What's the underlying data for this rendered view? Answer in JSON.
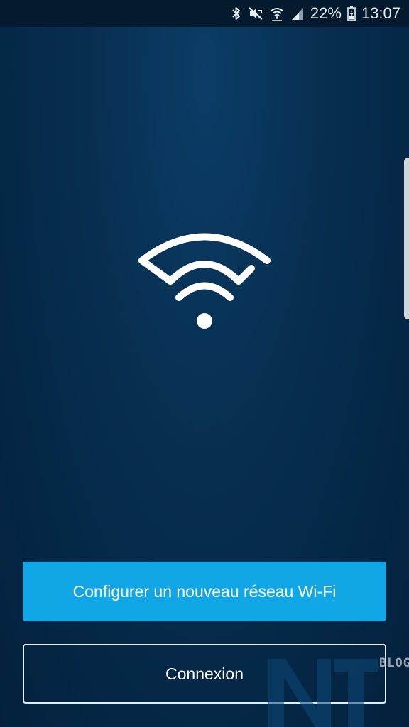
{
  "status_bar": {
    "battery_percent": "22%",
    "time": "13:07",
    "icons": [
      "bluetooth-icon",
      "mute-icon",
      "wifi-icon",
      "signal-icon",
      "battery-icon"
    ]
  },
  "main": {
    "logo_icon": "wifi-logo-icon",
    "primary_button_label": "Configurer un nouveau réseau Wi-Fi",
    "secondary_button_label": "Connexion"
  },
  "watermark": {
    "text": "BLOG"
  },
  "colors": {
    "primary_button": "#11a6e6",
    "background_top": "#0b3d66",
    "background_bottom": "#03213c"
  }
}
